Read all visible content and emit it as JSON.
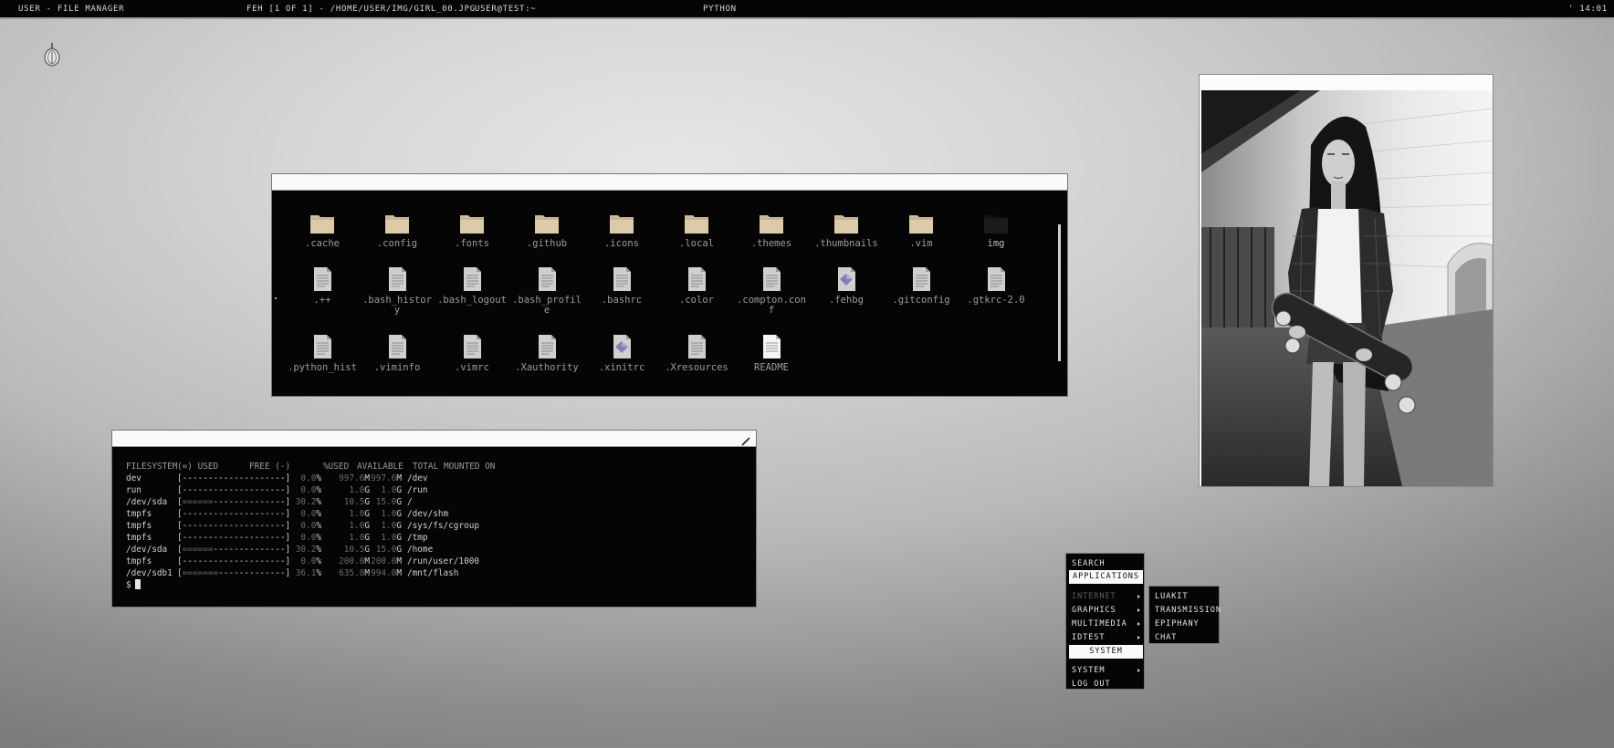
{
  "topbar": {
    "left_title": "USER - FILE MANAGER",
    "feh_title": "FEH [1 OF 1] - /HOME/USER/IMG/GIRL_00.JPG",
    "term_title": "USER@TEST:~",
    "python_title": "PYTHON",
    "clock": "' 14:01 '"
  },
  "file_manager": {
    "files": [
      {
        "name": ".cache",
        "icon": "folder-icon"
      },
      {
        "name": ".config",
        "icon": "folder-icon"
      },
      {
        "name": ".fonts",
        "icon": "folder-icon"
      },
      {
        "name": ".github",
        "icon": "folder-icon"
      },
      {
        "name": ".icons",
        "icon": "folder-icon"
      },
      {
        "name": ".local",
        "icon": "folder-icon"
      },
      {
        "name": ".themes",
        "icon": "folder-icon"
      },
      {
        "name": ".thumbnails",
        "icon": "folder-icon"
      },
      {
        "name": ".vim",
        "icon": "folder-icon"
      },
      {
        "name": "img",
        "icon": "folder-dark-icon"
      },
      {
        "name": ".++",
        "icon": "file-icon"
      },
      {
        "name": ".bash_history",
        "icon": "file-icon"
      },
      {
        "name": ".bash_logout",
        "icon": "file-icon"
      },
      {
        "name": ".bash_profile",
        "icon": "file-icon"
      },
      {
        "name": ".bashrc",
        "icon": "file-icon"
      },
      {
        "name": ".color",
        "icon": "file-icon"
      },
      {
        "name": ".compton.conf",
        "icon": "file-icon"
      },
      {
        "name": ".fehbg",
        "icon": "script-icon"
      },
      {
        "name": ".gitconfig",
        "icon": "file-icon"
      },
      {
        "name": ".gtkrc-2.0",
        "icon": "file-icon"
      },
      {
        "name": ".python_hist",
        "icon": "file-icon"
      },
      {
        "name": ".viminfo",
        "icon": "file-icon"
      },
      {
        "name": ".vimrc",
        "icon": "file-icon"
      },
      {
        "name": ".Xauthority",
        "icon": "file-icon"
      },
      {
        "name": ".xinitrc",
        "icon": "script-icon"
      },
      {
        "name": ".Xresources",
        "icon": "file-icon"
      },
      {
        "name": "README",
        "icon": "readme-icon"
      }
    ]
  },
  "terminal": {
    "header": {
      "fs": "FILESYSTEM",
      "bar": "(=) USED      FREE (-)",
      "pct": "%USED",
      "avail": "AVAILABLE",
      "total": "TOTAL",
      "mount": "MOUNTED ON"
    },
    "rows": [
      {
        "fs": "dev",
        "used_frac": 0.0,
        "pct": "0.0",
        "avail": "997.6",
        "avail_u": "M",
        "total": "997.6",
        "total_u": "M",
        "mount": "/dev"
      },
      {
        "fs": "run",
        "used_frac": 0.0,
        "pct": "0.0",
        "avail": "1.0",
        "avail_u": "G",
        "total": "1.0",
        "total_u": "G",
        "mount": "/run"
      },
      {
        "fs": "/dev/sda",
        "used_frac": 0.302,
        "pct": "30.2",
        "avail": "10.5",
        "avail_u": "G",
        "total": "15.0",
        "total_u": "G",
        "mount": "/"
      },
      {
        "fs": "tmpfs",
        "used_frac": 0.0,
        "pct": "0.0",
        "avail": "1.0",
        "avail_u": "G",
        "total": "1.0",
        "total_u": "G",
        "mount": "/dev/shm"
      },
      {
        "fs": "tmpfs",
        "used_frac": 0.0,
        "pct": "0.0",
        "avail": "1.0",
        "avail_u": "G",
        "total": "1.0",
        "total_u": "G",
        "mount": "/sys/fs/cgroup"
      },
      {
        "fs": "tmpfs",
        "used_frac": 0.0,
        "pct": "0.0",
        "avail": "1.0",
        "avail_u": "G",
        "total": "1.0",
        "total_u": "G",
        "mount": "/tmp"
      },
      {
        "fs": "/dev/sda",
        "used_frac": 0.302,
        "pct": "30.2",
        "avail": "10.5",
        "avail_u": "G",
        "total": "15.0",
        "total_u": "G",
        "mount": "/home"
      },
      {
        "fs": "tmpfs",
        "used_frac": 0.0,
        "pct": "0.0",
        "avail": "200.0",
        "avail_u": "M",
        "total": "200.0",
        "total_u": "M",
        "mount": "/run/user/1000"
      },
      {
        "fs": "/dev/sdb1",
        "used_frac": 0.361,
        "pct": "36.1",
        "avail": "635.0",
        "avail_u": "M",
        "total": "994.0",
        "total_u": "M",
        "mount": "/mnt/flash"
      }
    ],
    "prompt": "$"
  },
  "menu": {
    "search": "SEARCH",
    "applications": "APPLICATIONS",
    "internet": "INTERNET",
    "graphics": "GRAPHICS",
    "multimedia": "MULTIMEDIA",
    "idtest": "IDTEST",
    "system_header": "SYSTEM",
    "system": "SYSTEM",
    "logout": "LOG OUT"
  },
  "submenu": {
    "items": [
      "LUAKIT",
      "TRANSMISSION",
      "EPIPHANY",
      "CHAT"
    ]
  },
  "colors": {
    "background": "#c8c8c8",
    "window_bg": "#050505",
    "titlebar": "#fafafa",
    "folder": "#d9c9ac"
  }
}
